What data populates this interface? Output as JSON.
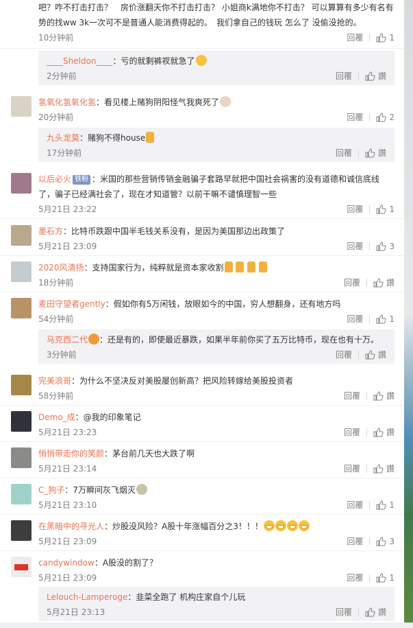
{
  "comments": [
    {
      "text": "吧？咋不打击打击？　房价涨翻天你不打击打击？ 小姐商k满地你不打击？ 可以算算有多少有名有势的找ww 3k一次可不是普通人能消费得起的。　我们拿自己的钱玩 怎么了 没偷没抢的。",
      "time": "10分钟前",
      "reply_label": "回覆",
      "likes": "1"
    },
    {
      "user": "氢氧化氢氧化氢",
      "text": "：看见楼上赌狗阴阳怪气我爽死了",
      "time": "20分钟前",
      "reply_label": "回覆",
      "likes": "2"
    },
    {
      "user": "以后必火",
      "badge": "铁粉",
      "text": "：米国的那些营销传销金融骗子套路早就把中国社会祸害的没有道德和诚信底线了，骗子已经满社会了，现在才知道管？以前干嘛不谴慎理智一些",
      "time": "5月21日 23:22",
      "reply_label": "回覆",
      "likes": "1"
    },
    {
      "user": "墨石方",
      "text": "：比特币跌跟中国半毛钱关系没有，是因为美国那边出政策了",
      "time": "5月21日 23:09",
      "reply_label": "回覆",
      "likes": "3"
    },
    {
      "user": "2020风清扬",
      "text": "：支持国家行为，纯粹就是资本家收割",
      "time": "18分钟前",
      "reply_label": "回覆",
      "likes": "讚"
    },
    {
      "user": "麦田守望者gently",
      "text": "：假如你有5万闲钱，放眼如今的中国，穷人想翻身，还有地方吗",
      "time": "54分钟前",
      "reply_label": "回覆",
      "likes": "1"
    },
    {
      "user": "完美浪哥",
      "text": "：为什么不坚决反对美股屡创新高？把风险转嫁给美股投资者",
      "time": "58分钟前",
      "reply_label": "回覆",
      "likes": "讚"
    },
    {
      "user": "Demo_成",
      "text": "：@我的印象笔记",
      "time": "5月21日 23:23",
      "reply_label": "回覆",
      "likes": "讚"
    },
    {
      "user": "悄悄带走你的笑颜",
      "text": "：茅台前几天也大跌了啊",
      "time": "5月21日 23:14",
      "reply_label": "回覆",
      "likes": "讚"
    },
    {
      "user": "C_狗子",
      "text": "：7万瞬间灰飞烟灭",
      "time": "5月21日 23:10",
      "reply_label": "回覆",
      "likes": "1"
    },
    {
      "user": "在黑暗中的寻光人",
      "text": "：炒股没风险？A股十年涨幅百分之3！！！",
      "time": "5月21日 23:09",
      "reply_label": "回覆",
      "likes": "3"
    },
    {
      "user": "candywindow",
      "text": "：A股没的割了？",
      "time": "5月21日 23:09",
      "reply_label": "回覆",
      "likes": "1"
    }
  ],
  "replies": [
    {
      "user": "____Sheldon____",
      "text": "：亏的就剩裤衩就急了",
      "time": "2分钟前",
      "reply_label": "回覆",
      "likes": "讚"
    },
    {
      "user": "九头龙莫",
      "text": "：赌狗不得house",
      "time": "17分钟前",
      "reply_label": "回覆",
      "likes": "讚"
    },
    {
      "user": "马克西二代",
      "text": "：还是有的，即使最近暴跌，如果半年前你买了五万比特币，现在也有十万。",
      "time": "3分钟前",
      "reply_label": "回覆",
      "likes": "讚"
    },
    {
      "user": "Lelouch-Lamperoge",
      "text": "：韭菜全跑了 机构庄家自个儿玩",
      "time": "5月21日 23:13",
      "reply_label": "回覆",
      "likes": "讚"
    }
  ]
}
